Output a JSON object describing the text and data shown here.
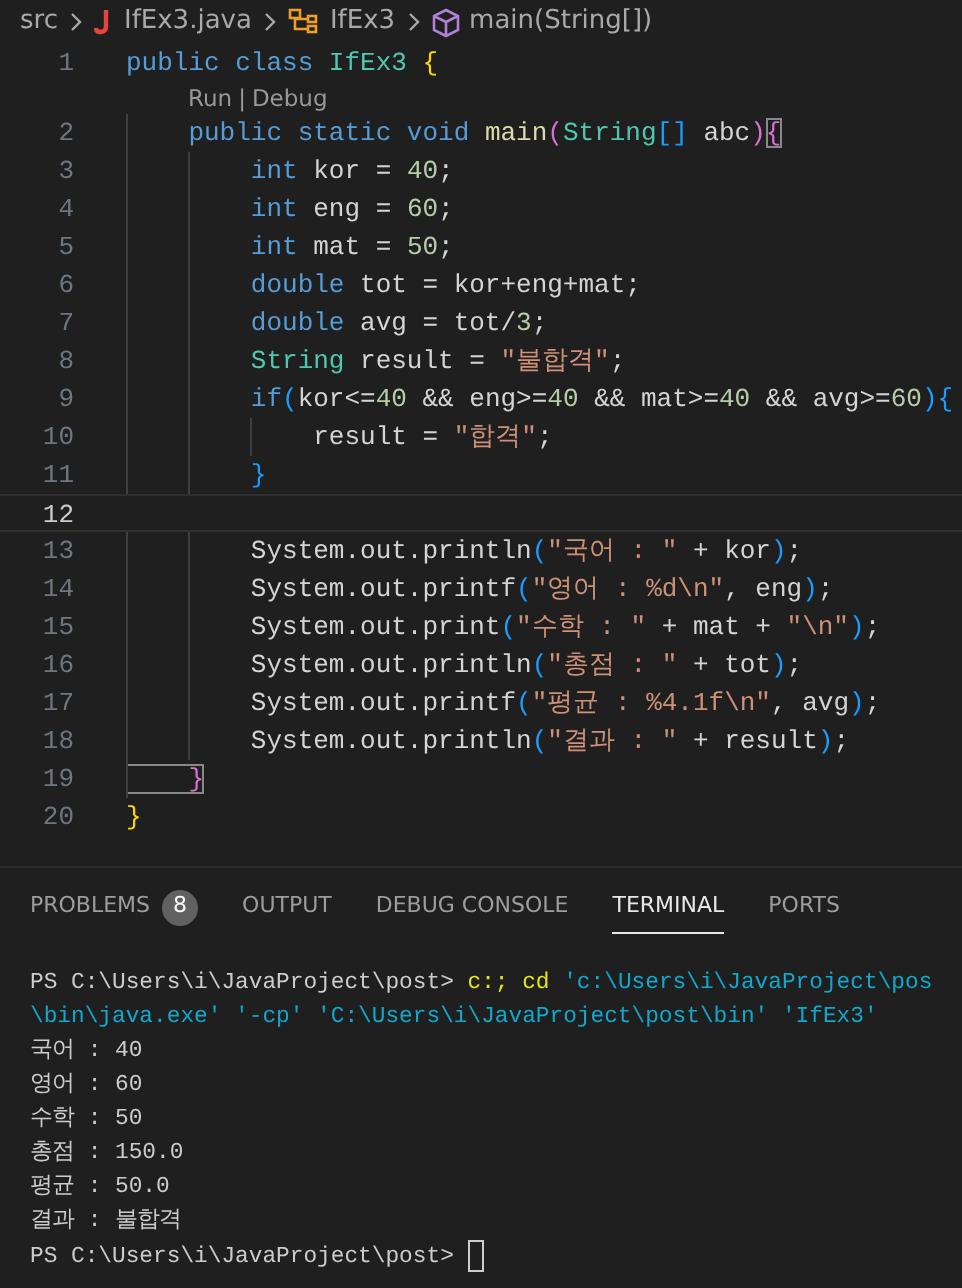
{
  "breadcrumb": [
    {
      "kind": "folder",
      "label": "src"
    },
    {
      "kind": "java",
      "label": "IfEx3.java"
    },
    {
      "kind": "class",
      "label": "IfEx3"
    },
    {
      "kind": "method",
      "label": "main(String[])"
    }
  ],
  "editor_lines": [
    {
      "number": "1",
      "current": false,
      "tokens": [
        {
          "text": "public",
          "kind": "kw"
        },
        {
          "text": " class",
          "kind": "kw"
        },
        {
          "text": " IfEx3",
          "kind": "type"
        },
        {
          "text": " {",
          "kind": "b1"
        }
      ],
      "codelens": [
        "Run",
        "|",
        "Debug"
      ]
    },
    {
      "number": "2",
      "current": false,
      "tokens": [
        {
          "text": "    public",
          "kind": "kw"
        },
        {
          "text": " static",
          "kind": "kw"
        },
        {
          "text": " void",
          "kind": "kw"
        },
        {
          "text": " main",
          "kind": "fn"
        },
        {
          "text": "(",
          "kind": "b2"
        },
        {
          "text": "String",
          "kind": "type"
        },
        {
          "text": "[]",
          "kind": "b3"
        },
        {
          "text": " abc"
        },
        {
          "text": ")",
          "kind": "b2"
        },
        {
          "text": "{",
          "kind": "b2",
          "matched": true
        }
      ]
    },
    {
      "number": "3",
      "current": false,
      "tokens": [
        {
          "text": "        int",
          "kind": "kw"
        },
        {
          "text": " kor = "
        },
        {
          "text": "40",
          "kind": "num"
        },
        {
          "text": ";"
        }
      ]
    },
    {
      "number": "4",
      "current": false,
      "tokens": [
        {
          "text": "        int",
          "kind": "kw"
        },
        {
          "text": " eng = "
        },
        {
          "text": "60",
          "kind": "num"
        },
        {
          "text": ";"
        }
      ]
    },
    {
      "number": "5",
      "current": false,
      "tokens": [
        {
          "text": "        int",
          "kind": "kw"
        },
        {
          "text": " mat = "
        },
        {
          "text": "50",
          "kind": "num"
        },
        {
          "text": ";"
        }
      ]
    },
    {
      "number": "6",
      "current": false,
      "tokens": [
        {
          "text": "        double",
          "kind": "kw"
        },
        {
          "text": " tot = kor+eng+mat;"
        }
      ]
    },
    {
      "number": "7",
      "current": false,
      "tokens": [
        {
          "text": "        double",
          "kind": "kw"
        },
        {
          "text": " avg = tot/"
        },
        {
          "text": "3",
          "kind": "num"
        },
        {
          "text": ";"
        }
      ]
    },
    {
      "number": "8",
      "current": false,
      "tokens": [
        {
          "text": "        String",
          "kind": "type"
        },
        {
          "text": " result = "
        },
        {
          "text": "\"불합격\"",
          "kind": "str"
        },
        {
          "text": ";"
        }
      ]
    },
    {
      "number": "9",
      "current": false,
      "tokens": [
        {
          "text": "        if",
          "kind": "kw"
        },
        {
          "text": "(",
          "kind": "b3"
        },
        {
          "text": "kor<="
        },
        {
          "text": "40",
          "kind": "num"
        },
        {
          "text": " && eng>="
        },
        {
          "text": "40",
          "kind": "num"
        },
        {
          "text": " && mat>="
        },
        {
          "text": "40",
          "kind": "num"
        },
        {
          "text": " && avg>="
        },
        {
          "text": "60",
          "kind": "num"
        },
        {
          "text": "){",
          "kind": "b3"
        }
      ]
    },
    {
      "number": "10",
      "current": false,
      "tokens": [
        {
          "text": "            result = "
        },
        {
          "text": "\"합격\"",
          "kind": "str"
        },
        {
          "text": ";"
        }
      ]
    },
    {
      "number": "11",
      "current": false,
      "tokens": [
        {
          "text": "        }",
          "kind": "b3"
        }
      ]
    },
    {
      "number": "12",
      "current": true
    },
    {
      "number": "13",
      "current": false,
      "tokens": [
        {
          "text": "        System.out.println"
        },
        {
          "text": "(",
          "kind": "b3"
        },
        {
          "text": "\"국어 : \"",
          "kind": "str"
        },
        {
          "text": " + kor"
        },
        {
          "text": ")",
          "kind": "b3"
        },
        {
          "text": ";"
        }
      ]
    },
    {
      "number": "14",
      "current": false,
      "tokens": [
        {
          "text": "        System.out.printf"
        },
        {
          "text": "(",
          "kind": "b3"
        },
        {
          "text": "\"영어 : %d\\n\"",
          "kind": "str"
        },
        {
          "text": ", eng"
        },
        {
          "text": ")",
          "kind": "b3"
        },
        {
          "text": ";"
        }
      ]
    },
    {
      "number": "15",
      "current": false,
      "tokens": [
        {
          "text": "        System.out.print"
        },
        {
          "text": "(",
          "kind": "b3"
        },
        {
          "text": "\"수학 : \"",
          "kind": "str"
        },
        {
          "text": " + mat + "
        },
        {
          "text": "\"\\n\"",
          "kind": "str"
        },
        {
          "text": ")",
          "kind": "b3"
        },
        {
          "text": ";"
        }
      ]
    },
    {
      "number": "16",
      "current": false,
      "tokens": [
        {
          "text": "        System.out.println"
        },
        {
          "text": "(",
          "kind": "b3"
        },
        {
          "text": "\"총점 : \"",
          "kind": "str"
        },
        {
          "text": " + tot"
        },
        {
          "text": ")",
          "kind": "b3"
        },
        {
          "text": ";"
        }
      ]
    },
    {
      "number": "17",
      "current": false,
      "tokens": [
        {
          "text": "        System.out.printf"
        },
        {
          "text": "(",
          "kind": "b3"
        },
        {
          "text": "\"평균 : %4.1f\\n\"",
          "kind": "str"
        },
        {
          "text": ", avg"
        },
        {
          "text": ")",
          "kind": "b3"
        },
        {
          "text": ";"
        }
      ]
    },
    {
      "number": "18",
      "current": false,
      "tokens": [
        {
          "text": "        System.out.println"
        },
        {
          "text": "(",
          "kind": "b3"
        },
        {
          "text": "\"결과 : \"",
          "kind": "str"
        },
        {
          "text": " + result"
        },
        {
          "text": ")",
          "kind": "b3"
        },
        {
          "text": ";"
        }
      ]
    },
    {
      "number": "19",
      "current": false,
      "tokens": [
        {
          "text": "    }",
          "kind": "b2",
          "matched": true
        }
      ]
    },
    {
      "number": "20",
      "current": false,
      "tokens": [
        {
          "text": "}",
          "kind": "b1"
        }
      ]
    }
  ],
  "panel_tabs": [
    {
      "label": "PROBLEMS",
      "badge": "8",
      "selected": false
    },
    {
      "label": "OUTPUT",
      "selected": false
    },
    {
      "label": "DEBUG CONSOLE",
      "selected": false
    },
    {
      "label": "TERMINAL",
      "selected": true
    },
    {
      "label": "PORTS",
      "selected": false
    }
  ],
  "terminal_lines": [
    {
      "tokens": [
        {
          "text": "PS C:\\Users\\i\\JavaProject\\post>"
        },
        {
          "text": "  c:; cd",
          "kind": "cmd"
        },
        {
          "text": " 'c:\\Users\\i\\JavaProject\\pos",
          "kind": "arg"
        }
      ]
    },
    {
      "tokens": [
        {
          "text": "\\bin\\java.exe' '-cp' 'C:\\Users\\i\\JavaProject\\post\\bin' 'IfEx3'",
          "kind": "arg"
        }
      ]
    },
    {
      "tokens": [
        {
          "text": "국어 : 40"
        }
      ]
    },
    {
      "tokens": [
        {
          "text": "영어 : 60"
        }
      ]
    },
    {
      "tokens": [
        {
          "text": "수학 : 50"
        }
      ]
    },
    {
      "tokens": [
        {
          "text": "총점 : 150.0"
        }
      ]
    },
    {
      "tokens": [
        {
          "text": "평균 : 50.0"
        }
      ]
    },
    {
      "tokens": [
        {
          "text": "결과 : 불합격"
        }
      ]
    },
    {
      "tokens": [
        {
          "text": "PS C:\\Users\\i\\JavaProject\\post> "
        }
      ],
      "cursor": true
    }
  ]
}
